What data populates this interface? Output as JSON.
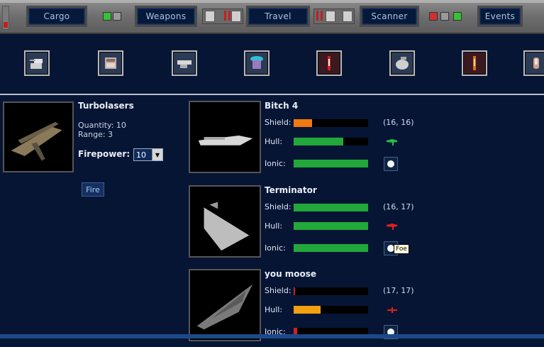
{
  "toolbar": {
    "buttons": [
      {
        "label": "Cargo"
      },
      {
        "label": "Weapons"
      },
      {
        "label": "Travel"
      },
      {
        "label": "Scanner"
      },
      {
        "label": "Events"
      }
    ]
  },
  "weapon_icons": [
    "turret-icon",
    "missile-launcher-icon",
    "cannon-icon",
    "shield-generator-icon",
    "torpedo-red-icon",
    "dome-turret-icon",
    "torpedo-orange-icon",
    "warhead-icon"
  ],
  "weapon": {
    "name": "Turbolasers",
    "quantity": "Quantity: 10",
    "range": "Range: 3",
    "firepower_label": "Firepower:",
    "firepower_value": "10",
    "fire_label": "Fire"
  },
  "labels": {
    "shield": "Shield:",
    "hull": "Hull:",
    "ionic": "Ionic:"
  },
  "targets": [
    {
      "name": "Bitch 4",
      "coords": "(16, 16)",
      "shield": 0.25,
      "hull": 0.67,
      "ionic": 1.0,
      "shield_color": "#f07a10",
      "hull_color": "#22a83a",
      "ionic_color": "#22a83a",
      "stance_color": "#24c040"
    },
    {
      "name": "Terminator",
      "coords": "(16, 17)",
      "shield": 1.0,
      "hull": 1.0,
      "ionic": 1.0,
      "shield_color": "#22a83a",
      "hull_color": "#22a83a",
      "ionic_color": "#22a83a",
      "stance_color": "#e02020",
      "tooltip": "Foe"
    },
    {
      "name": "you moose",
      "coords": "(17, 17)",
      "shield": 0.02,
      "hull": 0.36,
      "ionic": 0.05,
      "shield_color": "#c02020",
      "hull_color": "#f0a010",
      "ionic_color": "#d02020",
      "stance_color": "#e02020"
    }
  ]
}
